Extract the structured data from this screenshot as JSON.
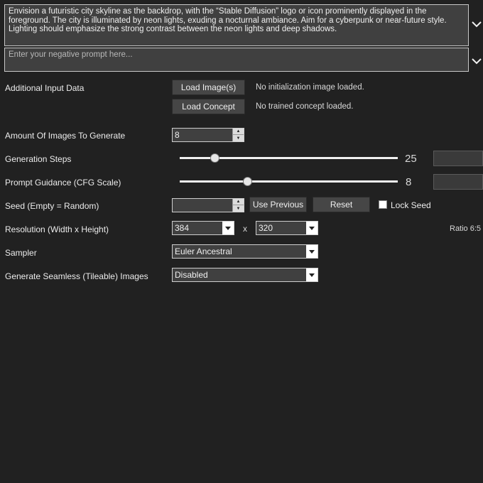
{
  "prompt": {
    "text": "Envision a futuristic city skyline as the backdrop, with the “Stable Diffusion” logo or icon prominently displayed in the foreground. The city is illuminated by neon lights, exuding a nocturnal ambiance. Aim for a cyberpunk or near-future style. Lighting should emphasize the strong contrast between the neon lights and deep shadows."
  },
  "negative_prompt": {
    "placeholder": "Enter your negative prompt here..."
  },
  "additional_input": {
    "label": "Additional Input Data",
    "load_image_button": "Load Image(s)",
    "image_status": "No initialization image loaded.",
    "load_concept_button": "Load Concept",
    "concept_status": "No trained concept loaded."
  },
  "amount": {
    "label": "Amount Of Images To Generate",
    "value": "8"
  },
  "steps": {
    "label": "Generation Steps",
    "value": "25",
    "fraction": 0.16
  },
  "guidance": {
    "label": "Prompt Guidance (CFG Scale)",
    "value": "8",
    "fraction": 0.31
  },
  "seed": {
    "label": "Seed (Empty = Random)",
    "value": "",
    "use_previous_button": "Use Previous",
    "reset_button": "Reset",
    "lock_label": "Lock Seed"
  },
  "resolution": {
    "label": "Resolution (Width x Height)",
    "width": "384",
    "separator": "x",
    "height": "320",
    "ratio": "Ratio 6:5"
  },
  "sampler": {
    "label": "Sampler",
    "value": "Euler Ancestral"
  },
  "seamless": {
    "label": "Generate Seamless (Tileable) Images",
    "value": "Disabled"
  },
  "colors": {
    "background": "#212121",
    "field": "#404040",
    "button": "#464646"
  },
  "icons": {
    "expand": "chevron-down-icon",
    "dropdown": "dropdown-arrow-icon",
    "spinner": "spinner-arrows-icon"
  }
}
